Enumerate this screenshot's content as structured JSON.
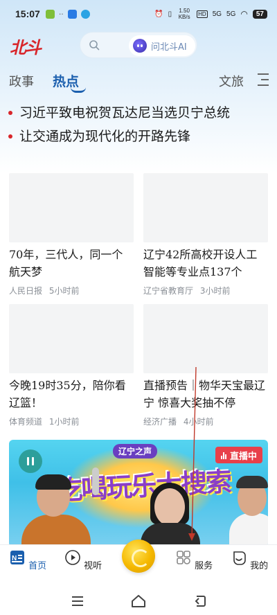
{
  "status_bar": {
    "time": "15:07",
    "network_1": "5G",
    "network_2": "5G",
    "speed": "1.50 KB/s",
    "battery": "57"
  },
  "header": {
    "logo_text": "北斗",
    "ai_button_label": "问北斗AI"
  },
  "tabs": [
    {
      "label": "政事"
    },
    {
      "label": "热点"
    },
    {
      "label": "文旅"
    }
  ],
  "headlines": [
    {
      "text": "习近平致电祝贺瓦达尼当选贝宁总统"
    },
    {
      "text": "让交通成为现代化的开路先锋"
    }
  ],
  "news_cards": [
    {
      "title": "70年，三代人，同一个航天梦",
      "source": "人民日报",
      "time": "5小时前"
    },
    {
      "title": "辽宁42所高校开设人工智能等专业点137个",
      "source": "辽宁省教育厅",
      "time": "3小时前"
    },
    {
      "title": "今晚19时35分，陪你看辽篮！",
      "source": "体育频道",
      "time": "1小时前"
    },
    {
      "title": "直播预告｜物华天宝最辽宁 惊喜大奖抽不停",
      "source": "经济广播",
      "time": "4小时前"
    }
  ],
  "video": {
    "live_label": "直播中",
    "banner_text": "吃喝玩乐大搜索",
    "station_label": "辽宁之声"
  },
  "bottom_nav": [
    {
      "label": "首页",
      "icon": "news-icon"
    },
    {
      "label": "视听",
      "icon": "play-icon"
    },
    {
      "label": "",
      "icon": "beidou-center-icon"
    },
    {
      "label": "服务",
      "icon": "service-icon"
    },
    {
      "label": "我的",
      "icon": "profile-icon"
    }
  ],
  "colors": {
    "accent": "#1b5fae",
    "brand_red": "#d8262b",
    "live_red": "#e8404a"
  }
}
